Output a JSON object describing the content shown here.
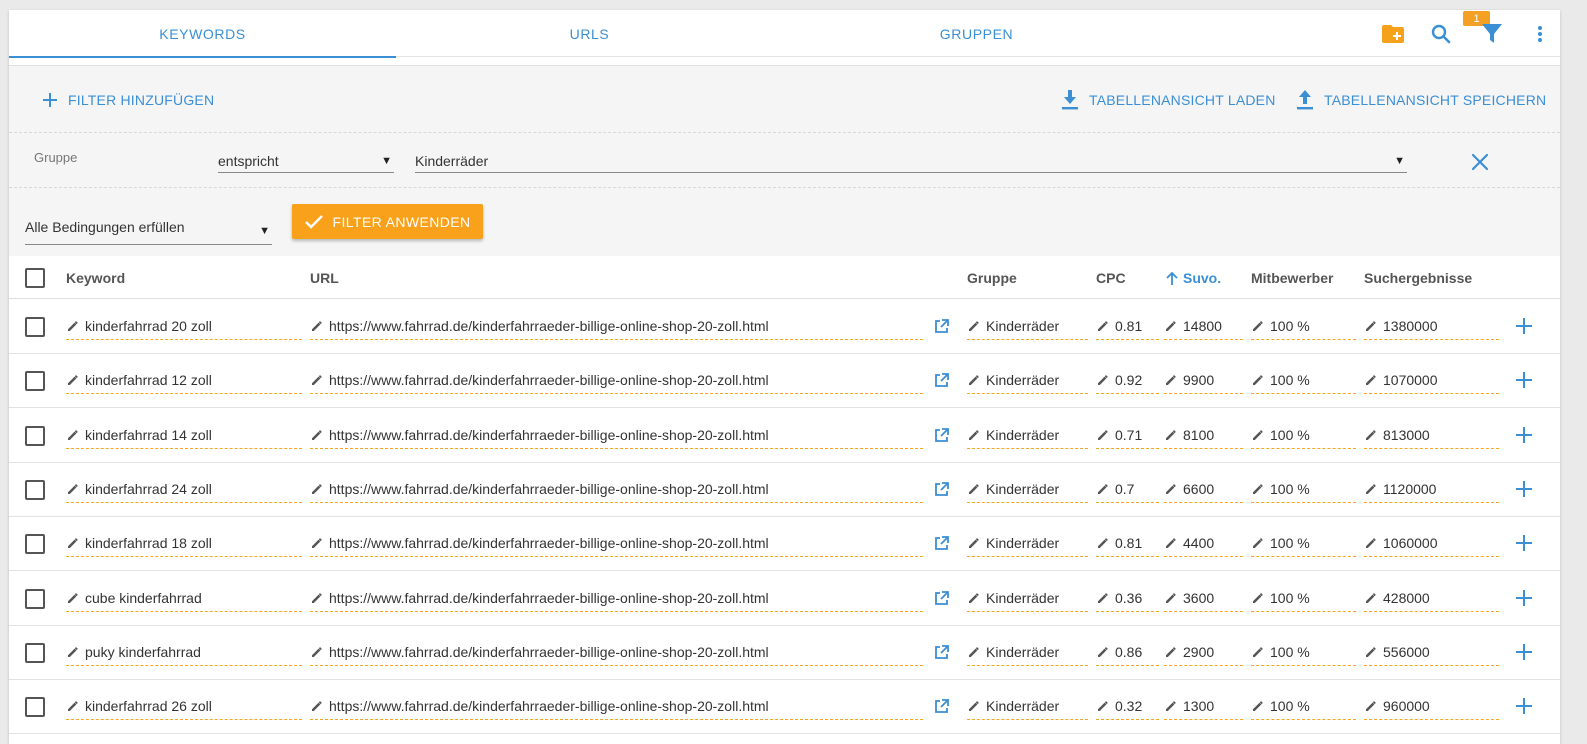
{
  "tabs": [
    {
      "label": "KEYWORDS",
      "active": true
    },
    {
      "label": "URLS",
      "active": false
    },
    {
      "label": "GRUPPEN",
      "active": false
    }
  ],
  "toolbar": {
    "icons": [
      "new-folder-icon",
      "search-icon",
      "filter-icon",
      "more-vert-icon"
    ],
    "filter_badge": "1"
  },
  "filter_panel": {
    "add_filter": "FILTER HINZUFÜGEN",
    "load_view": "TABELLENANSICHT LADEN",
    "save_view": "TABELLENANSICHT SPEICHERN",
    "rule": {
      "field": "Gruppe",
      "operator": "entspricht",
      "value": "Kinderräder"
    },
    "match_mode": "Alle Bedingungen erfüllen",
    "apply": "FILTER ANWENDEN"
  },
  "table": {
    "headers": {
      "keyword": "Keyword",
      "url": "URL",
      "group": "Gruppe",
      "cpc": "CPC",
      "volume": "Suvo.",
      "competition": "Mitbewerber",
      "results": "Suchergebnisse"
    },
    "sort_column": "Suvo.",
    "sort_direction": "ascending",
    "rows": [
      {
        "keyword": "kinderfahrrad 20 zoll",
        "url": "https://www.fahrrad.de/kinderfahrraeder-billige-online-shop-20-zoll.html",
        "group": "Kinderräder",
        "cpc": "0.81",
        "volume": "14800",
        "competition": "100 %",
        "results": "1380000"
      },
      {
        "keyword": "kinderfahrrad 12 zoll",
        "url": "https://www.fahrrad.de/kinderfahrraeder-billige-online-shop-20-zoll.html",
        "group": "Kinderräder",
        "cpc": "0.92",
        "volume": "9900",
        "competition": "100 %",
        "results": "1070000"
      },
      {
        "keyword": "kinderfahrrad 14 zoll",
        "url": "https://www.fahrrad.de/kinderfahrraeder-billige-online-shop-20-zoll.html",
        "group": "Kinderräder",
        "cpc": "0.71",
        "volume": "8100",
        "competition": "100 %",
        "results": "813000"
      },
      {
        "keyword": "kinderfahrrad 24 zoll",
        "url": "https://www.fahrrad.de/kinderfahrraeder-billige-online-shop-20-zoll.html",
        "group": "Kinderräder",
        "cpc": "0.7",
        "volume": "6600",
        "competition": "100 %",
        "results": "1120000"
      },
      {
        "keyword": "kinderfahrrad 18 zoll",
        "url": "https://www.fahrrad.de/kinderfahrraeder-billige-online-shop-20-zoll.html",
        "group": "Kinderräder",
        "cpc": "0.81",
        "volume": "4400",
        "competition": "100 %",
        "results": "1060000"
      },
      {
        "keyword": "cube kinderfahrrad",
        "url": "https://www.fahrrad.de/kinderfahrraeder-billige-online-shop-20-zoll.html",
        "group": "Kinderräder",
        "cpc": "0.36",
        "volume": "3600",
        "competition": "100 %",
        "results": "428000"
      },
      {
        "keyword": "puky kinderfahrrad",
        "url": "https://www.fahrrad.de/kinderfahrraeder-billige-online-shop-20-zoll.html",
        "group": "Kinderräder",
        "cpc": "0.86",
        "volume": "2900",
        "competition": "100 %",
        "results": "556000"
      },
      {
        "keyword": "kinderfahrrad 26 zoll",
        "url": "https://www.fahrrad.de/kinderfahrraeder-billige-online-shop-20-zoll.html",
        "group": "Kinderräder",
        "cpc": "0.32",
        "volume": "1300",
        "competition": "100 %",
        "results": "960000"
      }
    ]
  },
  "colors": {
    "accent": "#3b8fd5",
    "apply_button": "#f9a11b",
    "badge": "#f3a024",
    "editable_underline": "#f5a623"
  }
}
